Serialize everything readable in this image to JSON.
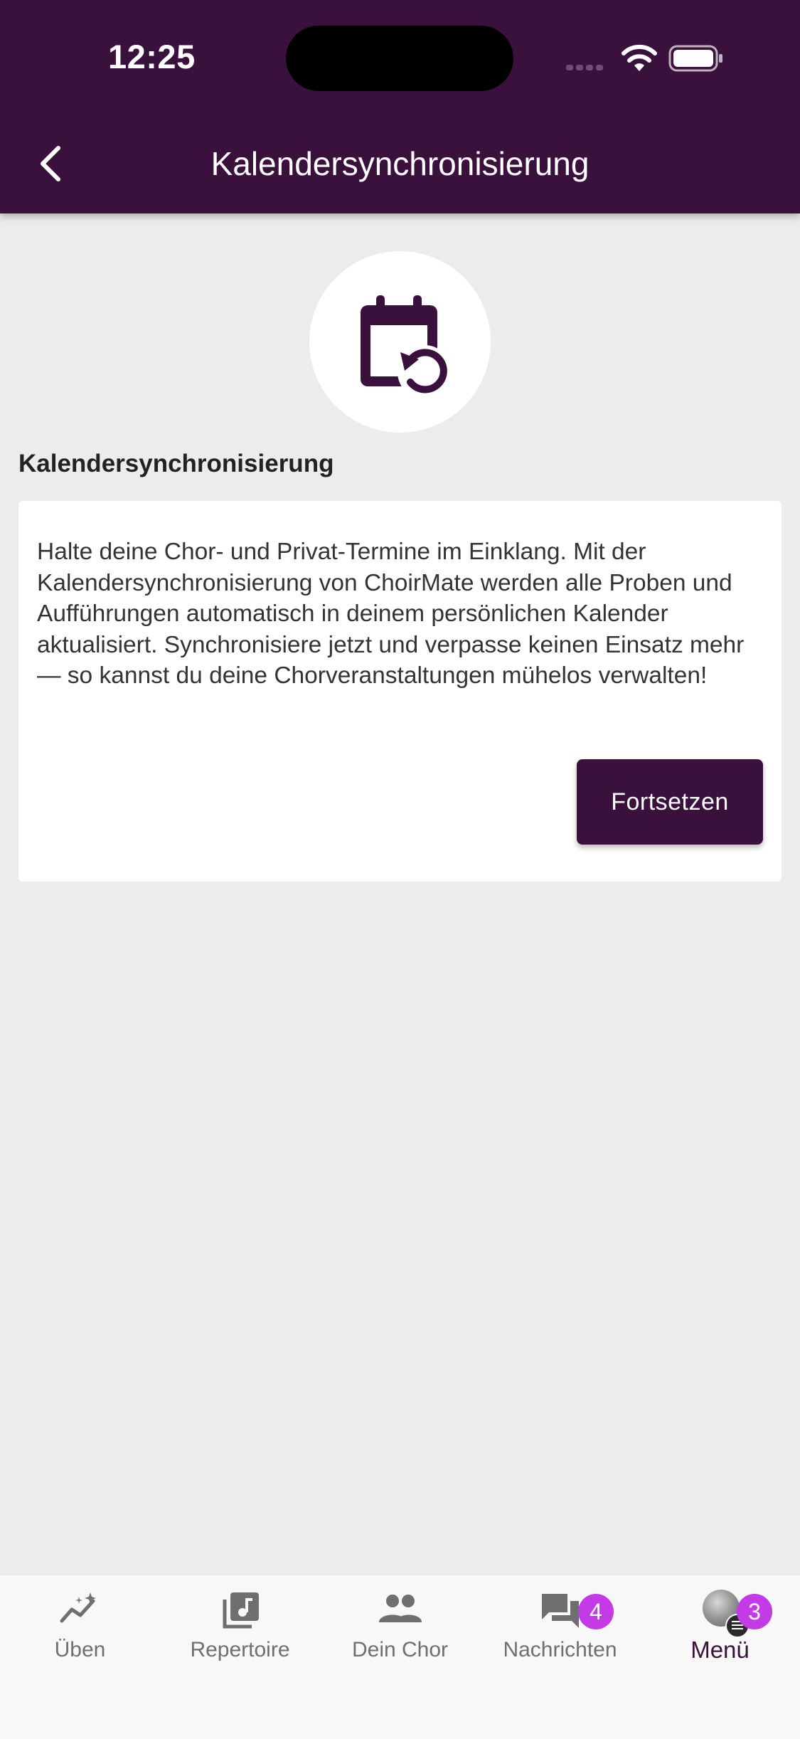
{
  "status_bar": {
    "time": "12:25"
  },
  "app_bar": {
    "title": "Kalendersynchronisierung"
  },
  "section": {
    "title": "Kalendersynchronisierung"
  },
  "card": {
    "description": "Halte deine Chor- und Privat-Termine im Einklang. Mit der Kalendersynchronisierung von ChoirMate werden alle Proben und Aufführungen automatisch in deinem persönlichen Kalender aktualisiert. Synchronisiere jetzt und verpasse keinen Einsatz mehr — so kannst du deine Chorveranstaltungen mühelos verwalten!",
    "button_label": "Fortsetzen"
  },
  "tabs": [
    {
      "label": "Üben",
      "icon": "practice-trend-icon"
    },
    {
      "label": "Repertoire",
      "icon": "music-library-icon"
    },
    {
      "label": "Dein Chor",
      "icon": "people-icon"
    },
    {
      "label": "Nachrichten",
      "icon": "chat-icon",
      "badge": "4"
    },
    {
      "label": "Menü",
      "icon": "avatar",
      "badge": "3",
      "active": true
    }
  ],
  "colors": {
    "primary": "#3a113c",
    "background": "#ececec",
    "badge": "#c43ae6",
    "inactive_tab": "#6f6f6f"
  }
}
